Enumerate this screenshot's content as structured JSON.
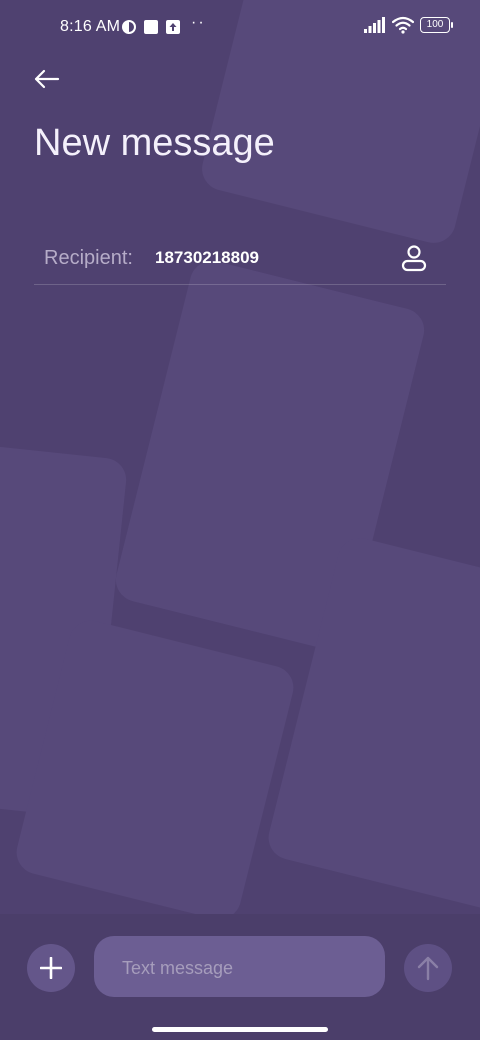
{
  "status_bar": {
    "time": "8:16 AM",
    "dots": "··",
    "battery": "100",
    "icons": [
      "app-notification-icon",
      "square-icon",
      "upload-icon",
      "signal-icon",
      "wifi-icon",
      "battery-icon"
    ]
  },
  "header": {
    "back_icon": "back-arrow-icon",
    "title": "New message"
  },
  "recipient": {
    "label": "Recipient:",
    "value": "18730218809",
    "contact_icon": "contact-person-icon"
  },
  "composer": {
    "attach_icon": "plus-icon",
    "placeholder": "Text message",
    "send_icon": "send-arrow-up-icon"
  },
  "colors": {
    "background": "#4f4170",
    "accent_field": "#6c5e93"
  }
}
